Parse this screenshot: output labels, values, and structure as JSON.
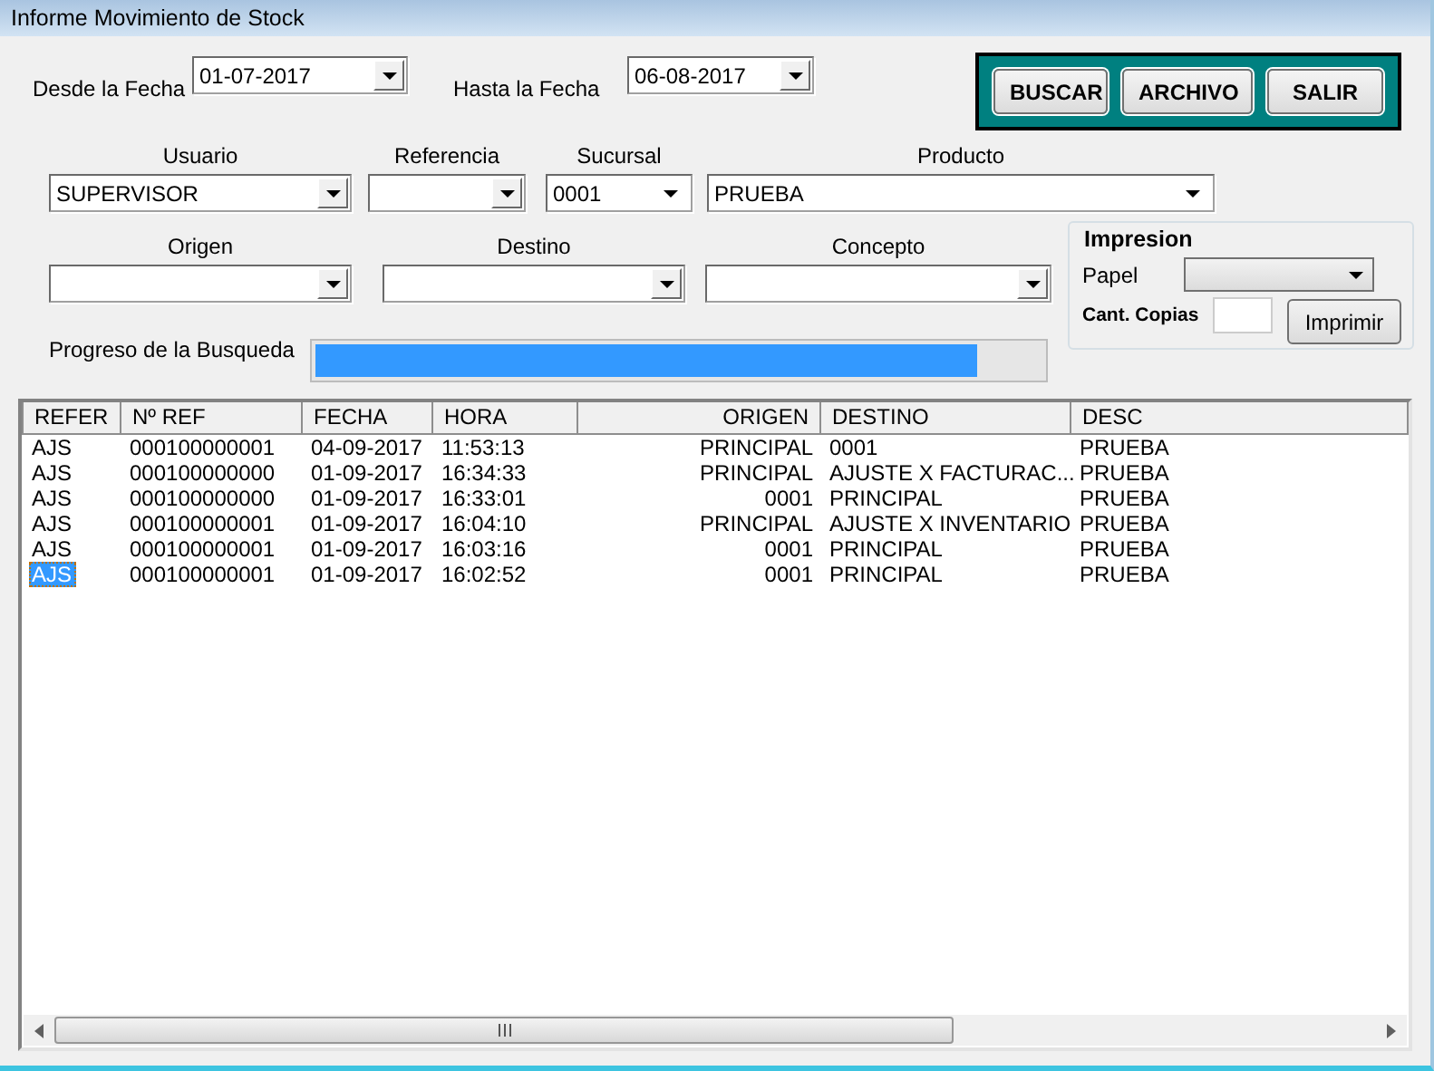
{
  "window": {
    "title": "Informe Movimiento de Stock"
  },
  "date_from": {
    "label": "Desde la Fecha",
    "value": "01-07-2017"
  },
  "date_to": {
    "label": "Hasta la Fecha",
    "value": "06-08-2017"
  },
  "actions": [
    "BUSCAR",
    "ARCHIVO",
    "SALIR"
  ],
  "filters": [
    {
      "label": "Usuario",
      "value": "SUPERVISOR",
      "kind": "button"
    },
    {
      "label": "Referencia",
      "kind": "button"
    },
    {
      "label": "Sucursal",
      "value": "0001",
      "kind": "flat"
    },
    {
      "label": "Producto",
      "value": "PRUEBA",
      "kind": "flat"
    },
    {
      "label": "Origen",
      "kind": "button"
    },
    {
      "label": "Destino",
      "kind": "button"
    },
    {
      "label": "Concepto",
      "kind": "button"
    }
  ],
  "print": {
    "title": "Impresion",
    "paper_label": "Papel",
    "copies_label": "Cant. Copias",
    "button": "Imprimir"
  },
  "progress": {
    "label": "Progreso de la Busqueda",
    "level": 0.91
  },
  "table": {
    "columns": [
      "REFER",
      "Nº REF",
      "FECHA",
      "HORA",
      "ORIGEN",
      "DESTINO",
      "DESC"
    ],
    "rows": [
      {
        "cells": [
          "AJS",
          "000100000001",
          "04-09-2017",
          "11:53:13",
          "PRINCIPAL",
          "0001",
          "PRUEBA"
        ],
        "selected": false
      },
      {
        "cells": [
          "AJS",
          "000100000000",
          "01-09-2017",
          "16:34:33",
          "PRINCIPAL",
          "AJUSTE X FACTURAC...",
          "PRUEBA"
        ],
        "selected": false
      },
      {
        "cells": [
          "AJS",
          "000100000000",
          "01-09-2017",
          "16:33:01",
          "0001",
          "PRINCIPAL",
          "PRUEBA"
        ],
        "selected": false
      },
      {
        "cells": [
          "AJS",
          "000100000001",
          "01-09-2017",
          "16:04:10",
          "PRINCIPAL",
          "AJUSTE X INVENTARIO",
          "PRUEBA"
        ],
        "selected": false
      },
      {
        "cells": [
          "AJS",
          "000100000001",
          "01-09-2017",
          "16:03:16",
          "0001",
          "PRINCIPAL",
          "PRUEBA"
        ],
        "selected": false
      },
      {
        "cells": [
          "AJS",
          "000100000001",
          "01-09-2017",
          "16:02:52",
          "0001",
          "PRINCIPAL",
          "PRUEBA"
        ],
        "selected": true
      }
    ]
  }
}
